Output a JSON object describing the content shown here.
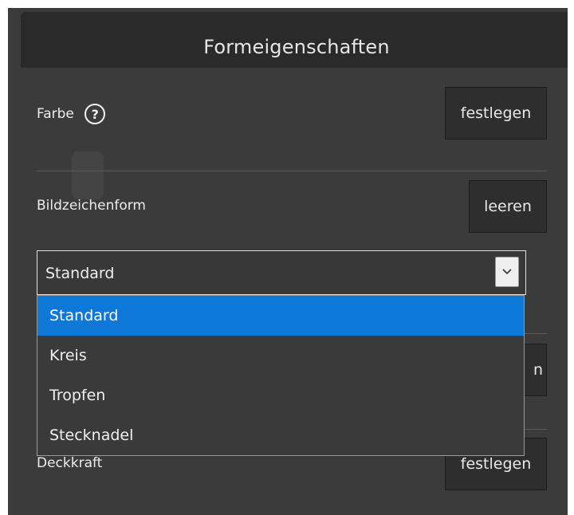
{
  "panel": {
    "title": "Formeigenschaften"
  },
  "color_row": {
    "label": "Farbe",
    "help_icon": "?",
    "button": "festlegen"
  },
  "icon_shape_row": {
    "label": "Bildzeichenform",
    "button": "leeren"
  },
  "shape_select": {
    "value": "Standard",
    "options": [
      "Standard",
      "Kreis",
      "Tropfen",
      "Stecknadel"
    ],
    "selected_index": 0
  },
  "hidden_row_button_fragment": "n",
  "opacity_row": {
    "label": "Deckkraft",
    "button": "festlegen"
  },
  "colors": {
    "selected_option": "#0d78d8",
    "panel_bg": "#3b3b3b",
    "header_bg": "#2a2a2a"
  }
}
